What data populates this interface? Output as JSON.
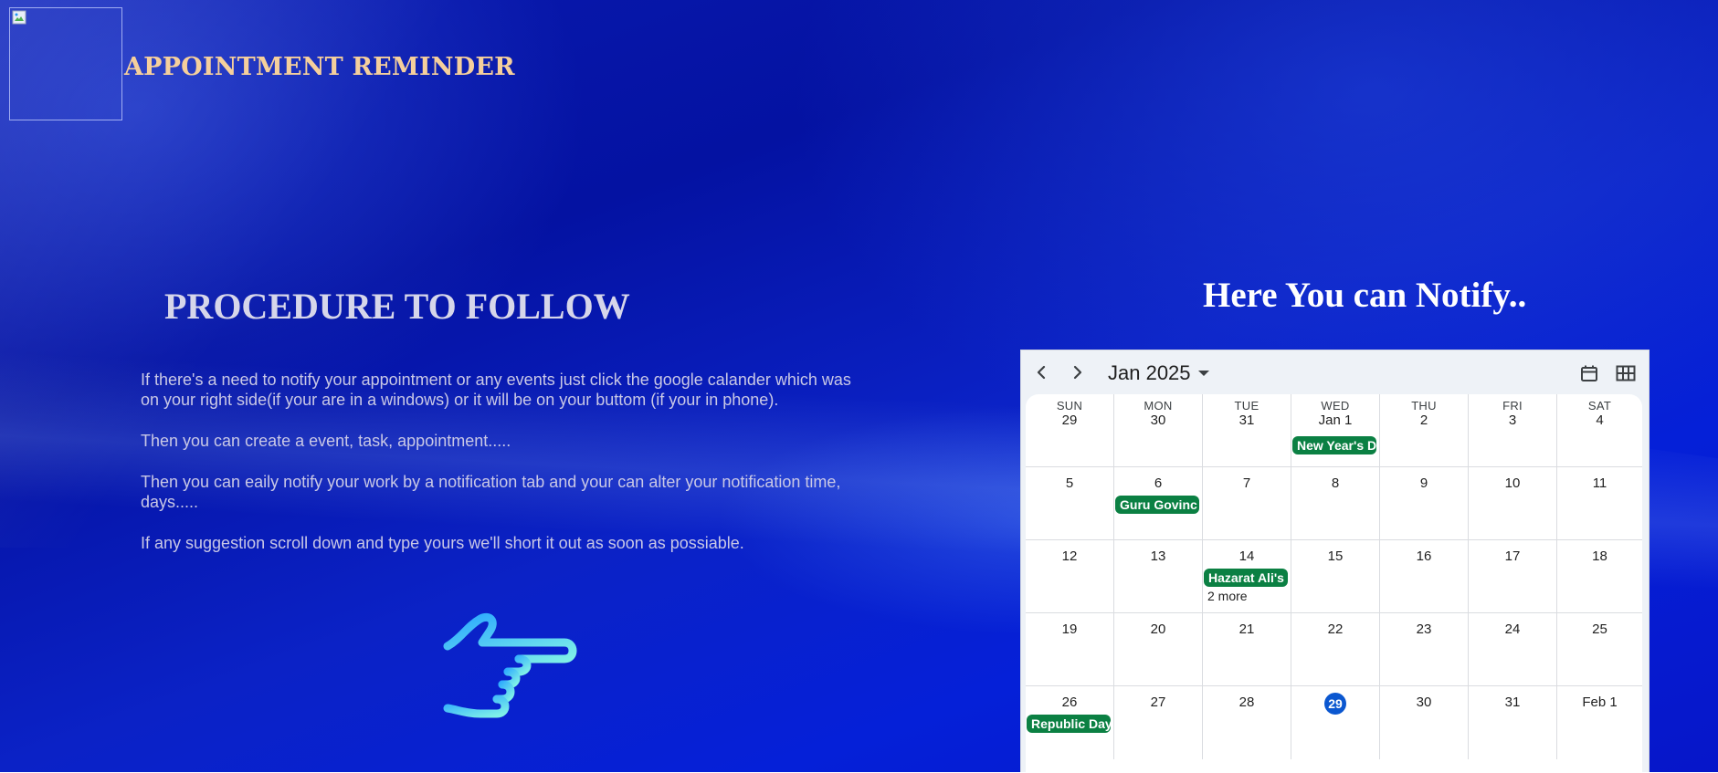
{
  "header": {
    "title": "APPOINTMENT REMINDER",
    "logo": "broken-image-icon"
  },
  "procedure": {
    "title": "PROCEDURE TO FOLLOW",
    "paragraphs": [
      "If there's a need to notify your appointment or any events just click the google calander which was on your right side(if your are in a windows) or it will be on your buttom (if your in phone).",
      "Then you can create a event, task, appointment.....",
      "Then you can eaily notify your work by a notification tab and your can alter your notification time, days.....",
      "If any suggestion scroll down and type yours we'll short it out as soon as possiable."
    ],
    "pointer_icon": "pointing-hand-icon"
  },
  "notify": {
    "title": "Here You can Notify.."
  },
  "calendar": {
    "month_label": "Jan 2025",
    "today": "29",
    "weekdays": [
      "SUN",
      "MON",
      "TUE",
      "WED",
      "THU",
      "FRI",
      "SAT"
    ],
    "weeks": [
      [
        "29",
        "30",
        "31",
        "Jan 1",
        "2",
        "3",
        "4"
      ],
      [
        "5",
        "6",
        "7",
        "8",
        "9",
        "10",
        "11"
      ],
      [
        "12",
        "13",
        "14",
        "15",
        "16",
        "17",
        "18"
      ],
      [
        "19",
        "20",
        "21",
        "22",
        "23",
        "24",
        "25"
      ],
      [
        "26",
        "27",
        "28",
        "29",
        "30",
        "31",
        "Feb 1"
      ]
    ],
    "events": [
      {
        "week": 0,
        "day": 3,
        "label": "New Year's D"
      },
      {
        "week": 1,
        "day": 1,
        "label": "Guru Govinc"
      },
      {
        "week": 2,
        "day": 2,
        "label": "Hazarat Ali's"
      },
      {
        "week": 4,
        "day": 0,
        "label": "Republic Day"
      }
    ],
    "more": [
      {
        "week": 2,
        "day": 2,
        "label": "2 more"
      }
    ],
    "colors": {
      "event": "#0b8043",
      "today": "#0b57d0"
    }
  }
}
